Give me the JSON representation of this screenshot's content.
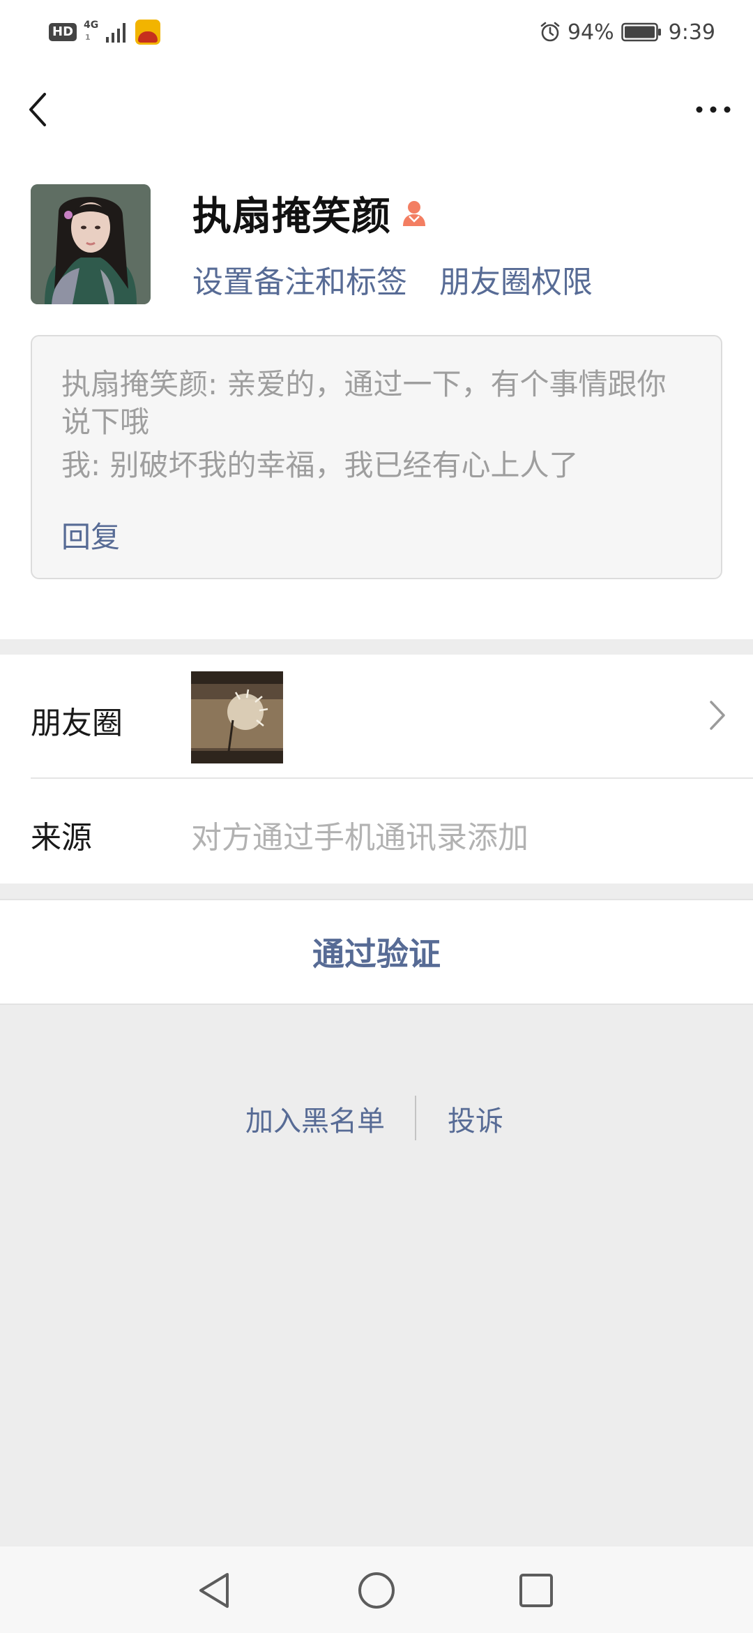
{
  "status_bar": {
    "hd_label": "HD",
    "network_label": "4G",
    "network_sub": "1",
    "battery_percent": "94%",
    "time": "9:39",
    "app_icon": "sogou-input-icon"
  },
  "profile": {
    "name": "执扇掩笑颜",
    "gender_icon": "female-icon",
    "link_remark": "设置备注和标签",
    "link_moments_permission": "朋友圈权限"
  },
  "message_card": {
    "line1": "执扇掩笑颜: 亲爱的，通过一下，有个事情跟你说下哦",
    "line2": "我: 别破坏我的幸福，我已经有心上人了",
    "reply_label": "回复"
  },
  "info": {
    "moments_label": "朋友圈",
    "source_label": "来源",
    "source_value": "对方通过手机通讯录添加"
  },
  "actions": {
    "verify_label": "通过验证",
    "blacklist_label": "加入黑名单",
    "report_label": "投诉"
  },
  "colors": {
    "link": "#576b95",
    "background": "#ededed",
    "gender_icon": "#f37e62"
  }
}
